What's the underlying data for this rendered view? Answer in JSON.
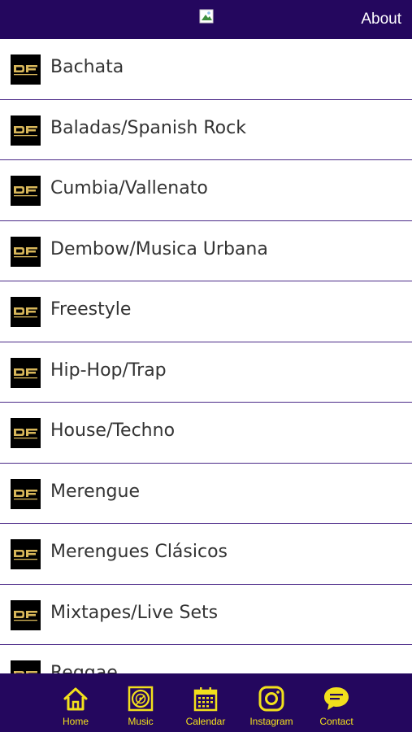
{
  "header": {
    "about_label": "About"
  },
  "genres": [
    {
      "label": "Bachata"
    },
    {
      "label": "Baladas/Spanish Rock"
    },
    {
      "label": "Cumbia/Vallenato"
    },
    {
      "label": "Dembow/Musica Urbana"
    },
    {
      "label": "Freestyle"
    },
    {
      "label": "Hip-Hop/Trap"
    },
    {
      "label": "House/Techno"
    },
    {
      "label": "Merengue"
    },
    {
      "label": "Merengues Clásicos"
    },
    {
      "label": "Mixtapes/Live Sets"
    },
    {
      "label": "Reggae"
    }
  ],
  "nav": {
    "home": "Home",
    "music": "Music",
    "calendar": "Calendar",
    "instagram": "Instagram",
    "contact": "Contact"
  },
  "colors": {
    "brand_purple": "#24075e",
    "accent_yellow": "#f2e01c",
    "divider": "#4b2a88"
  }
}
